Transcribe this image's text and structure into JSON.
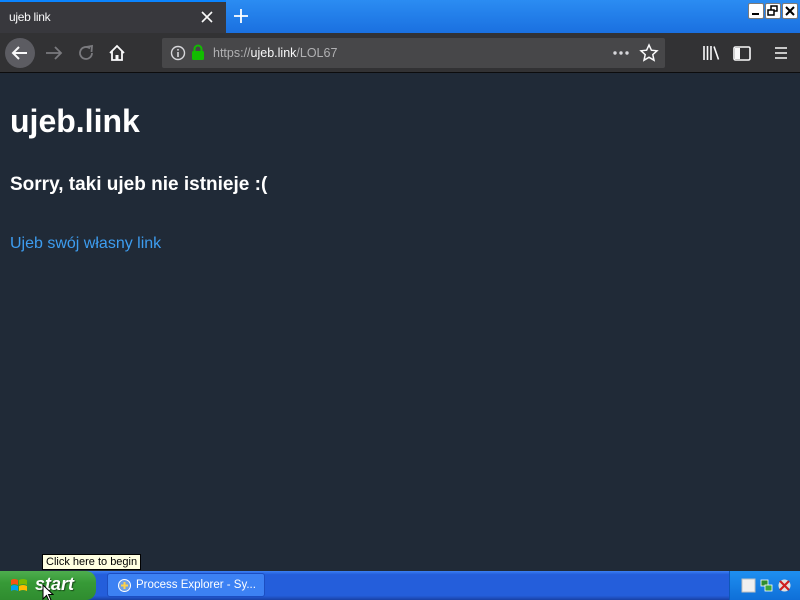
{
  "browser": {
    "tab_title": "ujeb link",
    "url_scheme": "https://",
    "url_domain": "ujeb.link",
    "url_path": "/LOL67"
  },
  "page": {
    "title": "ujeb.link",
    "message": "Sorry, taki ujeb nie istnieje :(",
    "link_text": "Ujeb swój własny link"
  },
  "tooltip": "Click here to begin",
  "taskbar": {
    "start_label": "start",
    "task_label": "Process Explorer - Sy..."
  },
  "colors": {
    "page_bg": "#202a37",
    "link": "#3d9df0",
    "tab_accent": "#0a84ff",
    "secure_lock": "#12bc00"
  },
  "icons": [
    "close-icon",
    "plus-icon",
    "back-arrow-icon",
    "forward-arrow-icon",
    "reload-icon",
    "home-icon",
    "info-icon",
    "lock-icon",
    "more-dots-icon",
    "star-icon",
    "library-icon",
    "sidebar-icon",
    "menu-icon",
    "windows-logo-icon",
    "process-explorer-icon"
  ]
}
